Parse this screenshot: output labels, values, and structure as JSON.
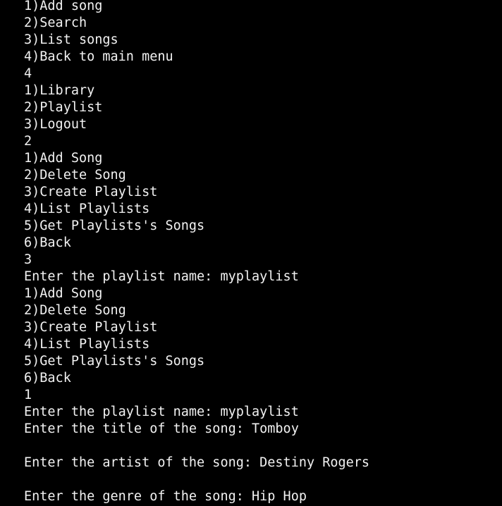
{
  "console": {
    "lines": [
      "1)Add song",
      "2)Search",
      "3)List songs",
      "4)Back to main menu",
      "4",
      "1)Library",
      "2)Playlist",
      "3)Logout",
      "2",
      "1)Add Song",
      "2)Delete Song",
      "3)Create Playlist",
      "4)List Playlists",
      "5)Get Playlists's Songs",
      "6)Back",
      "3",
      "Enter the playlist name: myplaylist",
      "1)Add Song",
      "2)Delete Song",
      "3)Create Playlist",
      "4)List Playlists",
      "5)Get Playlists's Songs",
      "6)Back",
      "1",
      "Enter the playlist name: myplaylist",
      "Enter the title of the song: Tomboy",
      "",
      "Enter the artist of the song: Destiny Rogers",
      "",
      "Enter the genre of the song: Hip Hop"
    ]
  },
  "colors": {
    "background": "#000000",
    "text": "#f2f2f2"
  }
}
